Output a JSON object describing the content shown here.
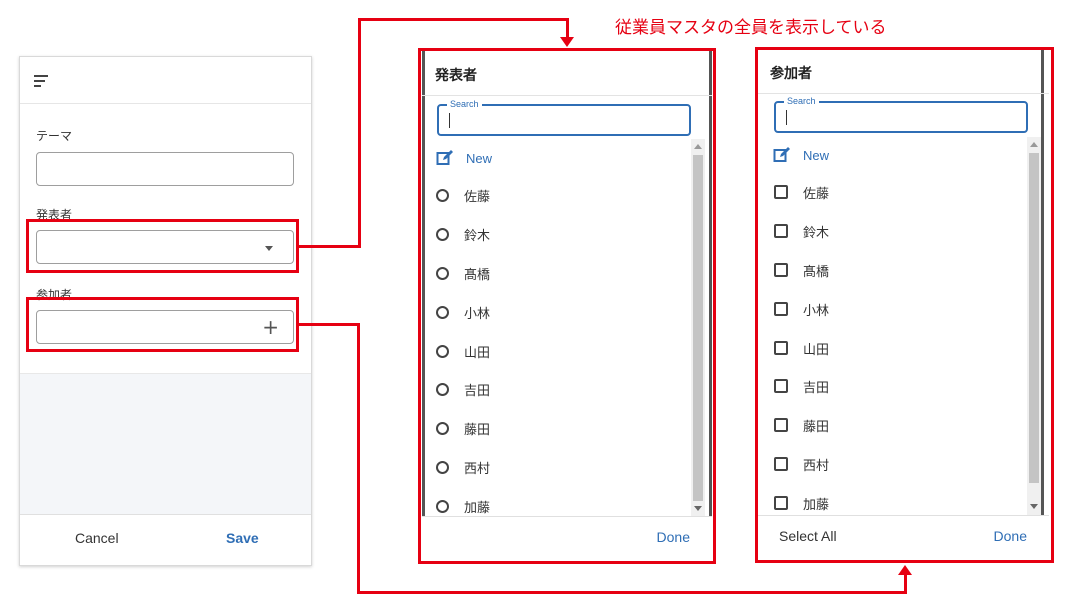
{
  "annotation": "従業員マスタの全員を表示している",
  "form": {
    "theme_label": "テーマ",
    "presenter_label": "発表者",
    "participants_label": "参加者",
    "cancel_label": "Cancel",
    "save_label": "Save"
  },
  "presenter_panel": {
    "title": "発表者",
    "search_label": "Search",
    "new_label": "New",
    "items": [
      "佐藤",
      "鈴木",
      "髙橋",
      "小林",
      "山田",
      "吉田",
      "藤田",
      "西村",
      "加藤"
    ],
    "done_label": "Done"
  },
  "participants_panel": {
    "title": "参加者",
    "search_label": "Search",
    "new_label": "New",
    "items": [
      "佐藤",
      "鈴木",
      "髙橋",
      "小林",
      "山田",
      "吉田",
      "藤田",
      "西村",
      "加藤"
    ],
    "select_all_label": "Select All",
    "done_label": "Done"
  },
  "colors": {
    "accent": "#2f6eb5",
    "annotation_red": "#e60012"
  }
}
